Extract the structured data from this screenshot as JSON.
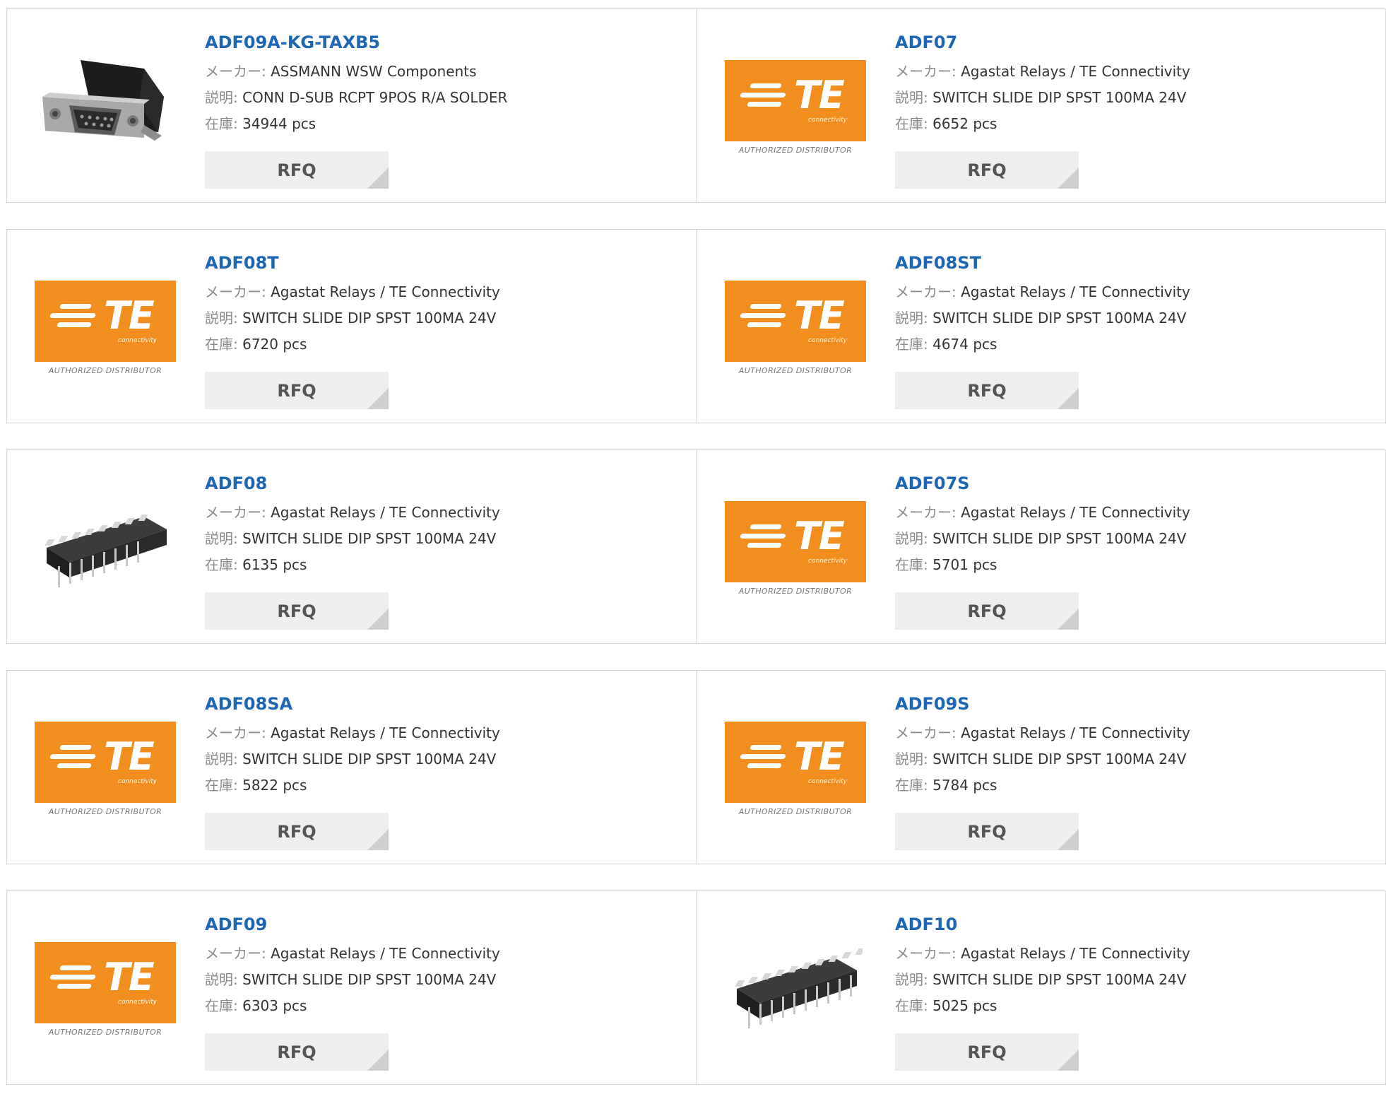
{
  "labels": {
    "maker": "メーカー:",
    "desc": "説明:",
    "stock": "在庫:",
    "rfq": "RFQ"
  },
  "te_logo": {
    "letters": "TE",
    "sub": "connectivity",
    "authorized": "AUTHORIZED DISTRIBUTOR",
    "color": "#f28e1e"
  },
  "products": [
    {
      "part": "ADF09A-KG-TAXB5",
      "maker": "ASSMANN WSW Components",
      "desc": "CONN D-SUB RCPT 9POS R/A SOLDER",
      "stock": "34944 pcs",
      "image": "dsub-connector-photo"
    },
    {
      "part": "ADF07",
      "maker": "Agastat Relays / TE Connectivity",
      "desc": "SWITCH SLIDE DIP SPST 100MA 24V",
      "stock": "6652 pcs",
      "image": "te-logo"
    },
    {
      "part": "ADF08T",
      "maker": "Agastat Relays / TE Connectivity",
      "desc": "SWITCH SLIDE DIP SPST 100MA 24V",
      "stock": "6720 pcs",
      "image": "te-logo"
    },
    {
      "part": "ADF08ST",
      "maker": "Agastat Relays / TE Connectivity",
      "desc": "SWITCH SLIDE DIP SPST 100MA 24V",
      "stock": "4674 pcs",
      "image": "te-logo"
    },
    {
      "part": "ADF08",
      "maker": "Agastat Relays / TE Connectivity",
      "desc": "SWITCH SLIDE DIP SPST 100MA 24V",
      "stock": "6135 pcs",
      "image": "dip-switch-photo"
    },
    {
      "part": "ADF07S",
      "maker": "Agastat Relays / TE Connectivity",
      "desc": "SWITCH SLIDE DIP SPST 100MA 24V",
      "stock": "5701 pcs",
      "image": "te-logo"
    },
    {
      "part": "ADF08SA",
      "maker": "Agastat Relays / TE Connectivity",
      "desc": "SWITCH SLIDE DIP SPST 100MA 24V",
      "stock": "5822 pcs",
      "image": "te-logo"
    },
    {
      "part": "ADF09S",
      "maker": "Agastat Relays / TE Connectivity",
      "desc": "SWITCH SLIDE DIP SPST 100MA 24V",
      "stock": "5784 pcs",
      "image": "te-logo"
    },
    {
      "part": "ADF09",
      "maker": "Agastat Relays / TE Connectivity",
      "desc": "SWITCH SLIDE DIP SPST 100MA 24V",
      "stock": "6303 pcs",
      "image": "te-logo"
    },
    {
      "part": "ADF10",
      "maker": "Agastat Relays / TE Connectivity",
      "desc": "SWITCH SLIDE DIP SPST 100MA 24V",
      "stock": "5025 pcs",
      "image": "dip-switch-photo"
    }
  ]
}
